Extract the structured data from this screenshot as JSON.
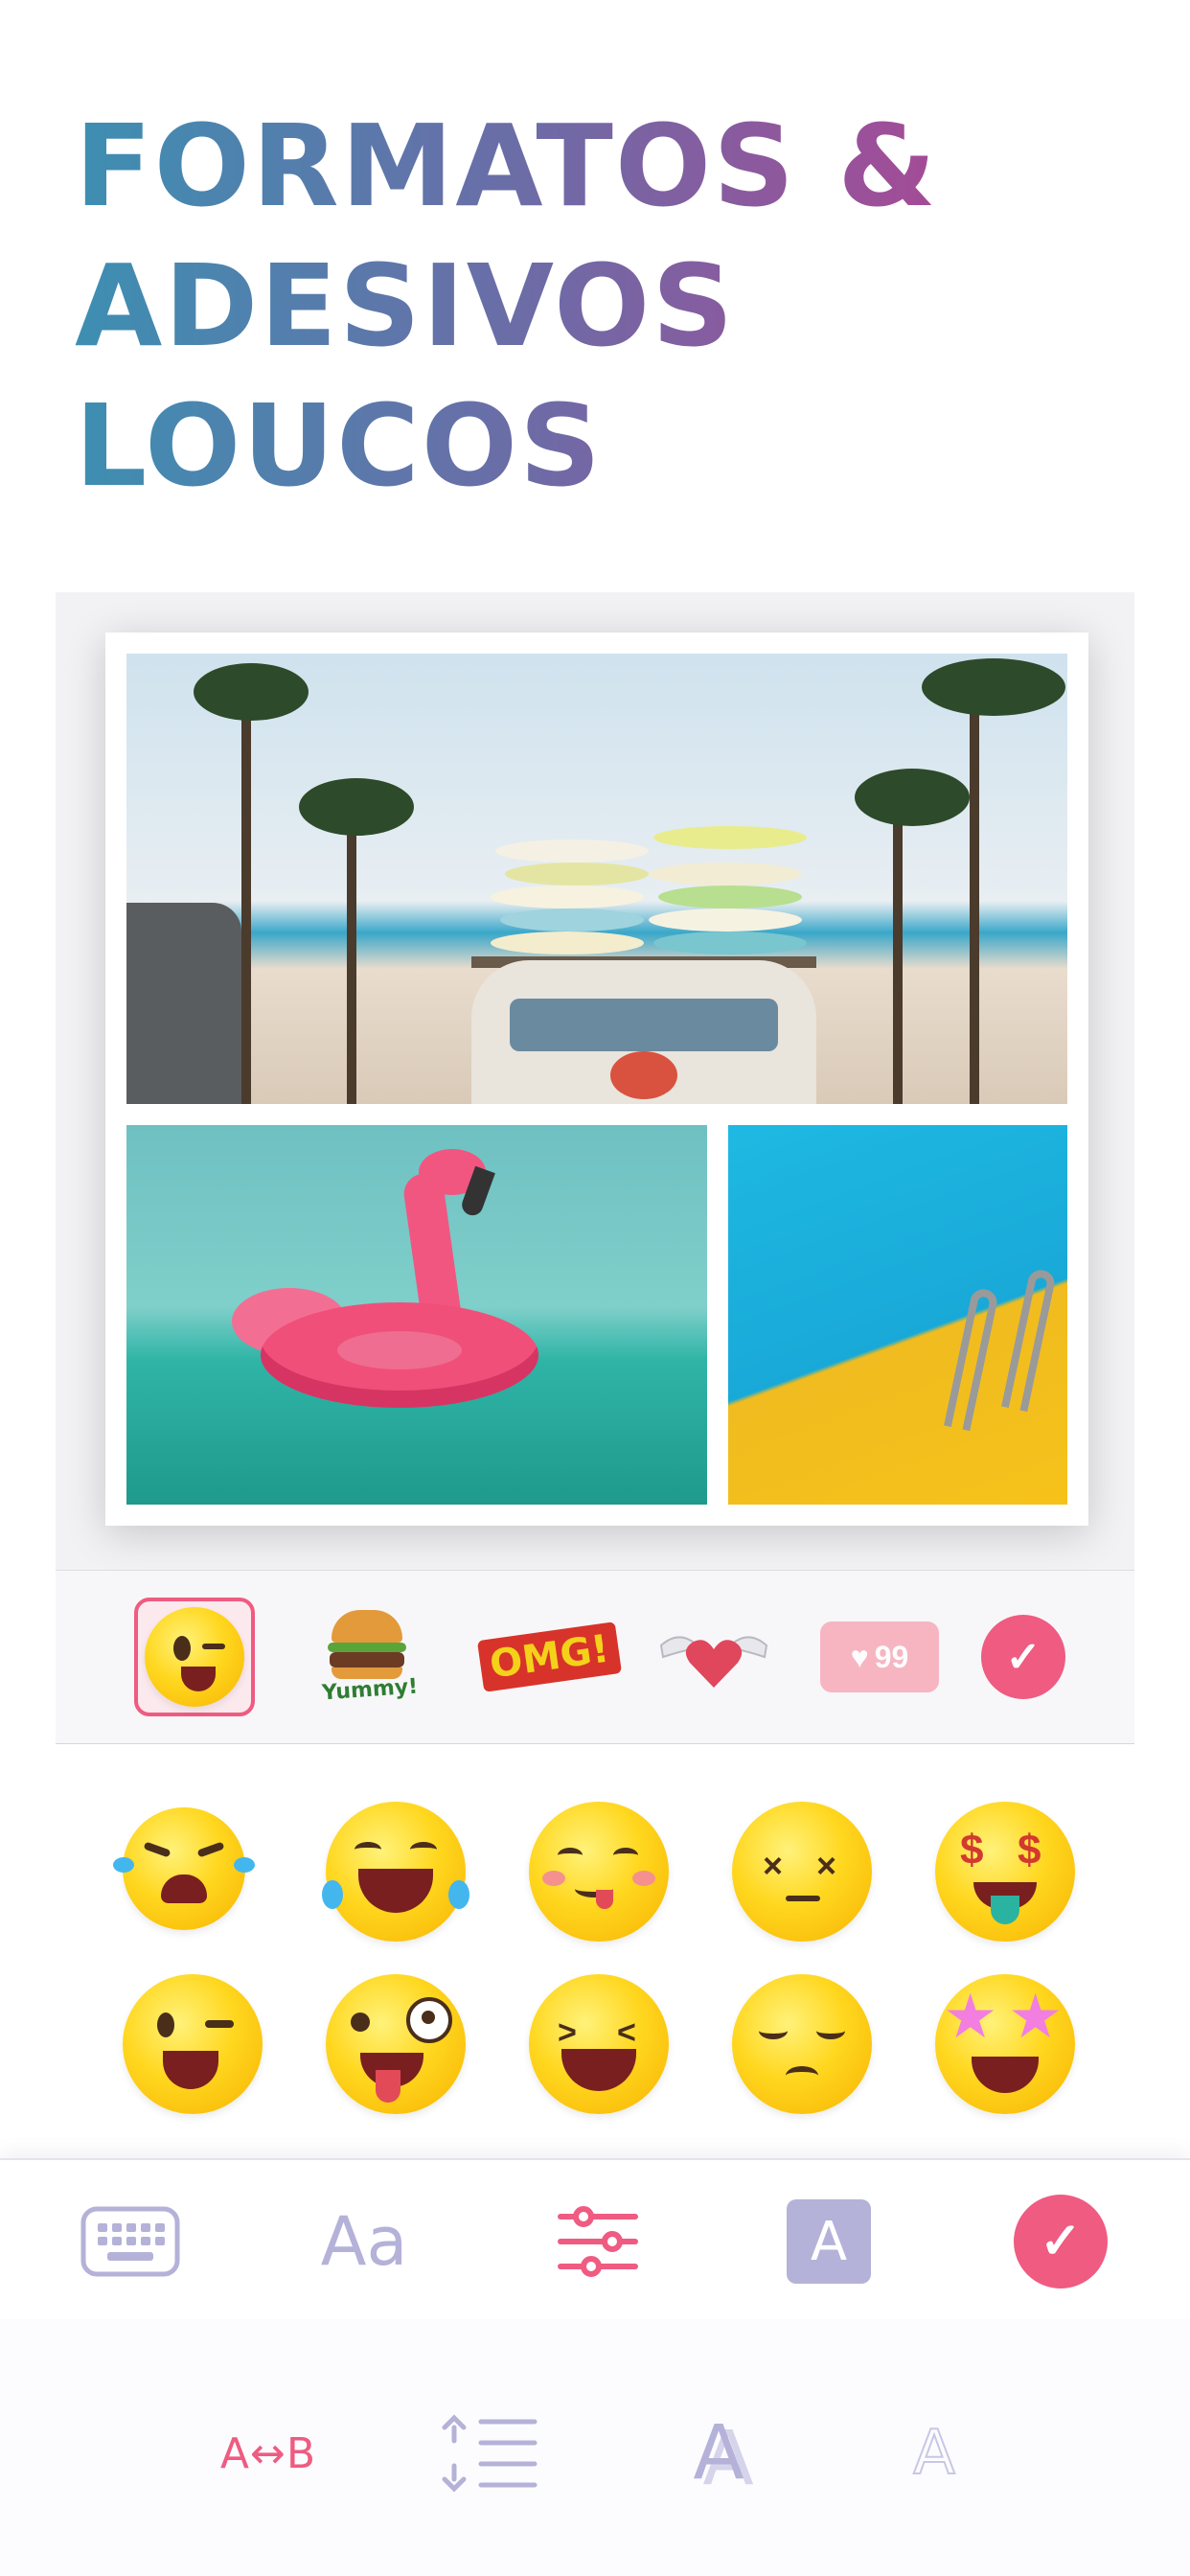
{
  "headline": {
    "lines": [
      "FORMATOS &",
      "ADESIVOS",
      "LOUCOS"
    ]
  },
  "sticker_categories": {
    "items": [
      "wink-emoji-sticker",
      "yummy-burger-sticker",
      "omg-sticker",
      "winged-heart-sticker",
      "like-counter-sticker"
    ],
    "yummy_label": "Yummy!",
    "omg_label": "OMG!",
    "like_count": "99",
    "selected_index": 0
  },
  "emoji_grid": {
    "row1": [
      "crying-laughing-emoji",
      "tears-of-joy-emoji",
      "yum-emoji",
      "dizzy-emoji",
      "money-mouth-emoji"
    ],
    "row2": [
      "wink-emoji",
      "zany-emoji",
      "grinning-squint-emoji",
      "pensive-emoji",
      "star-struck-emoji"
    ]
  },
  "toolbar": {
    "font_label": "Aa",
    "bg_label": "A"
  },
  "subtoolbar": {
    "spacing_label": "A↔B",
    "shadow_label": "A",
    "outline_label": "A"
  },
  "colors": {
    "accent": "#ef5b81",
    "muted_icon": "#b4b2d8",
    "headline_start": "#3d8fb2",
    "headline_end": "#b04493"
  }
}
